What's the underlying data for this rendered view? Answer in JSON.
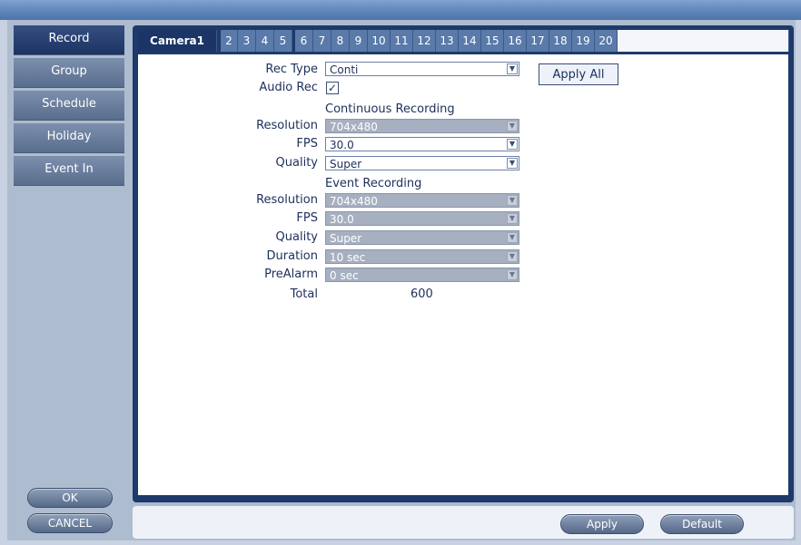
{
  "sidebar": {
    "items": [
      {
        "label": "Record"
      },
      {
        "label": "Group"
      },
      {
        "label": "Schedule"
      },
      {
        "label": "Holiday"
      },
      {
        "label": "Event In"
      }
    ],
    "ok_label": "OK",
    "cancel_label": "CANCEL"
  },
  "tabs": [
    "Camera1",
    "2",
    "3",
    "4",
    "5",
    "6",
    "7",
    "8",
    "9",
    "10",
    "11",
    "12",
    "13",
    "14",
    "15",
    "16",
    "17",
    "18",
    "19",
    "20"
  ],
  "form": {
    "rec_type_label": "Rec Type",
    "rec_type_value": "Conti",
    "audio_rec_label": "Audio Rec",
    "audio_rec_check": "✓",
    "apply_all_label": "Apply All",
    "continuous_title": "Continuous Recording",
    "continuous": {
      "resolution_label": "Resolution",
      "resolution_value": "704x480",
      "fps_label": "FPS",
      "fps_value": "30.0",
      "quality_label": "Quality",
      "quality_value": "Super"
    },
    "event_title": "Event Recording",
    "event": {
      "resolution_label": "Resolution",
      "resolution_value": "704x480",
      "fps_label": "FPS",
      "fps_value": "30.0",
      "quality_label": "Quality",
      "quality_value": "Super",
      "duration_label": "Duration",
      "duration_value": "10 sec",
      "prealarm_label": "PreAlarm",
      "prealarm_value": "0 sec"
    },
    "total_label": "Total",
    "total_value": "600"
  },
  "footer": {
    "apply_label": "Apply",
    "default_label": "Default"
  },
  "colors": {
    "accent": "#1c3463",
    "panel": "#1e3a6b"
  }
}
